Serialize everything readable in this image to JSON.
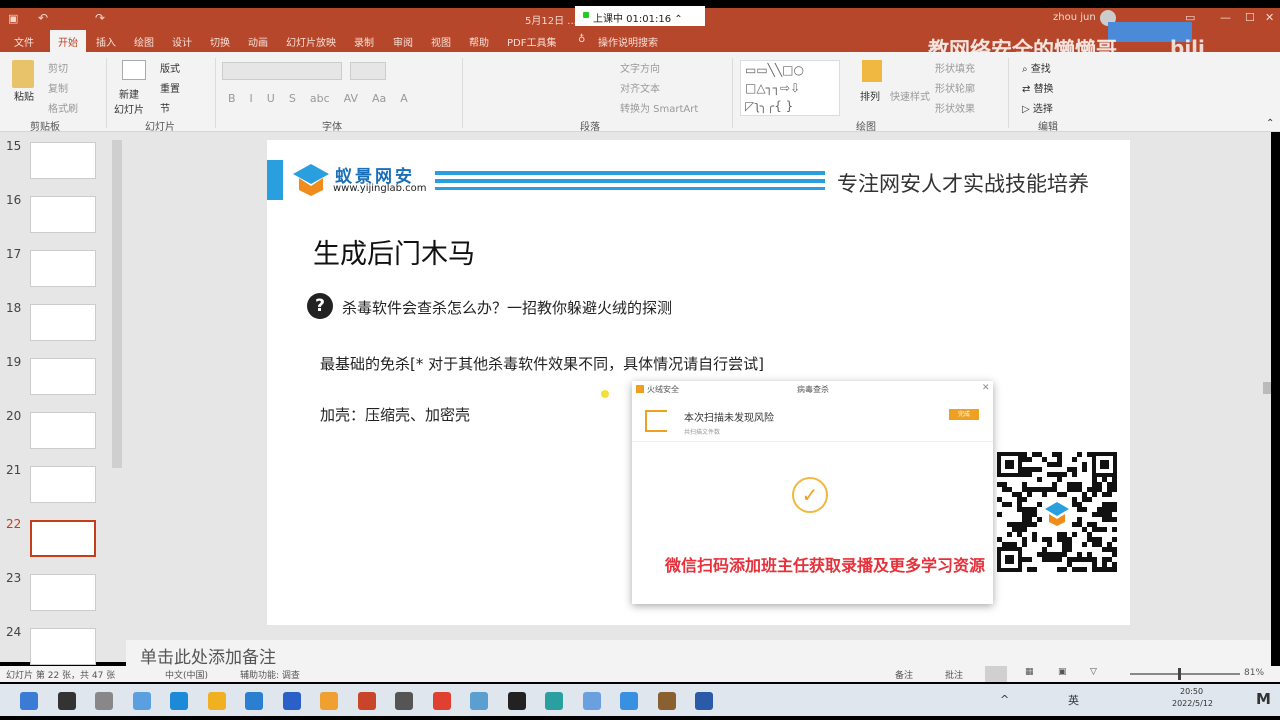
{
  "titlebar": {
    "doc_title": "5月12日 ... PowerPoint",
    "timer": "上课中 01:01:16",
    "user": "zhou jun"
  },
  "tabs": [
    "文件",
    "开始",
    "插入",
    "绘图",
    "设计",
    "切换",
    "动画",
    "幻灯片放映",
    "录制",
    "审阅",
    "视图",
    "帮助",
    "PDF工具集",
    "操作说明搜索"
  ],
  "ribbon": {
    "clipboard": {
      "paste": "粘贴",
      "cut": "剪切",
      "copy": "复制",
      "format_painter": "格式刷",
      "label": "剪贴板"
    },
    "slides": {
      "new_slide": "新建\n幻灯片",
      "layout": "版式",
      "reset": "重置",
      "section": "节",
      "label": "幻灯片"
    },
    "font": {
      "label": "字体",
      "buttons": [
        "B",
        "I",
        "U",
        "S",
        "abc",
        "AV",
        "Aa",
        "A"
      ]
    },
    "paragraph": {
      "label": "段落",
      "text_direction": "文字方向",
      "align_text": "对齐文本",
      "smartart": "转换为 SmartArt"
    },
    "drawing": {
      "label": "绘图",
      "arrange": "排列",
      "quick_styles": "快速样式",
      "shape_fill": "形状填充",
      "shape_outline": "形状轮廓",
      "shape_effects": "形状效果"
    },
    "editing": {
      "label": "编辑",
      "find": "查找",
      "replace": "替换",
      "select": "选择"
    }
  },
  "watermark": "教网络安全的懒懒哥",
  "thumbnails": [
    "15",
    "16",
    "17",
    "18",
    "19",
    "20",
    "21",
    "22",
    "23",
    "24"
  ],
  "slide": {
    "brand_name": "蚁景网安",
    "brand_url": "www.yijinglab.com",
    "slogan": "专注网安人才实战技能培养",
    "title": "生成后门木马",
    "question": "杀毒软件会查杀怎么办？一招教你躲避火绒的探测",
    "line1": "最基础的免杀[* 对于其他杀毒软件效果不同，具体情况请自行尝试]",
    "line2": "加壳：压缩壳、加密壳"
  },
  "popup": {
    "app": "火绒安全",
    "window_title": "病毒查杀",
    "result": "本次扫描未发现风险",
    "sub": "共扫描文件数",
    "button": "完成"
  },
  "overlay_text": "微信扫码添加班主任获取录播及更多学习资源",
  "notes_placeholder": "单击此处添加备注",
  "status": {
    "slide_info": "幻灯片 第 22 张，共 47 张",
    "language": "中文(中国)",
    "accessibility": "辅助功能: 调查",
    "notes": "备注",
    "comments": "批注",
    "zoom": "81%"
  },
  "tray": {
    "ime": "英",
    "time": "20:50",
    "date": "2022/5/12"
  },
  "colors": {
    "accent": "#b7472a",
    "brand_blue": "#2a9fe0",
    "overlay_red": "#e8303a",
    "huorong_orange": "#f0a020"
  }
}
